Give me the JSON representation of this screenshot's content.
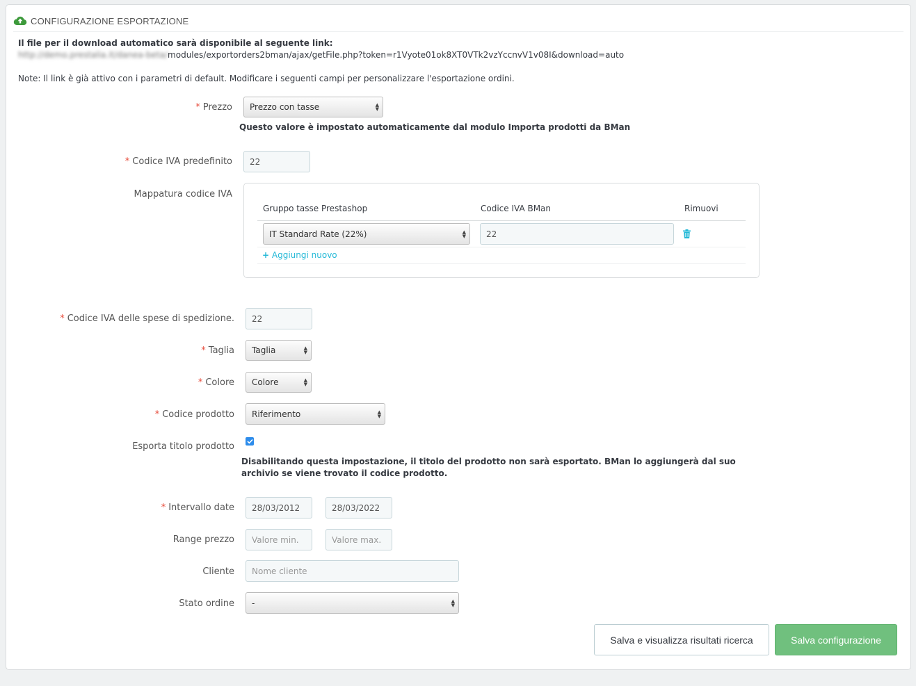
{
  "header": {
    "title": "CONFIGURAZIONE ESPORTAZIONE"
  },
  "intro": {
    "line1": "Il file per il download automatico sarà disponibile al seguente link:",
    "url_blurred": "http://demo.prestalia.it/danea-beta/",
    "url_path": "modules/exportorders2bman/ajax/getFile.php?token=r1Vyote01ok8XT0VTk2vzYccnvV1v08I&download=auto",
    "note": "Note: Il link è già attivo con i parametri di default. Modificare i seguenti campi per personalizzare l'esportazione ordini."
  },
  "prezzo": {
    "label": "Prezzo",
    "value": "Prezzo con tasse",
    "help": "Questo valore è impostato automaticamente dal modulo Importa prodotti da BMan"
  },
  "codice_iva": {
    "label": "Codice IVA predefinito",
    "value": "22"
  },
  "mappatura": {
    "label": "Mappatura codice IVA",
    "col_group": "Gruppo tasse Prestashop",
    "col_code": "Codice IVA BMan",
    "col_remove": "Rimuovi",
    "row_group": "IT Standard Rate (22%)",
    "row_code": "22",
    "add_label": "Aggiungi nuovo"
  },
  "spedizione": {
    "label": "Codice IVA delle spese di spedizione.",
    "value": "22"
  },
  "taglia": {
    "label": "Taglia",
    "value": "Taglia"
  },
  "colore": {
    "label": "Colore",
    "value": "Colore"
  },
  "codice_prodotto": {
    "label": "Codice prodotto",
    "value": "Riferimento"
  },
  "esporta_titolo": {
    "label": "Esporta titolo prodotto",
    "checked": true,
    "help_line1": "Disabilitando questa impostazione, il titolo del prodotto non sarà esportato. BMan lo aggiungerà dal suo",
    "help_line2": "archivio se viene trovato il codice prodotto."
  },
  "intervallo": {
    "label": "Intervallo date",
    "from": "28/03/2012",
    "to": "28/03/2022"
  },
  "range_prezzo": {
    "label": "Range prezzo",
    "min_placeholder": "Valore min.",
    "max_placeholder": "Valore max."
  },
  "cliente": {
    "label": "Cliente",
    "placeholder": "Nome cliente"
  },
  "stato": {
    "label": "Stato ordine",
    "value": "-"
  },
  "buttons": {
    "search": "Salva e visualizza risultati ricerca",
    "save": "Salva configurazione"
  },
  "colors": {
    "accent": "#25b9d7",
    "success": "#70c07e",
    "required": "#e74c3c"
  },
  "icons": {
    "header": "cloud-upload-icon",
    "remove": "trash-icon",
    "add": "plus-icon",
    "select": "select-arrows-icon"
  }
}
